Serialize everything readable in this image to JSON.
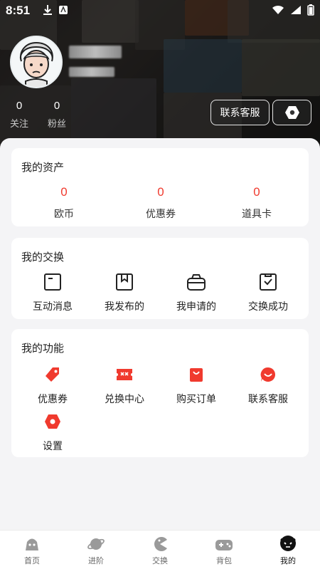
{
  "status_bar": {
    "time": "8:51"
  },
  "profile": {
    "following_count": "0",
    "following_label": "关注",
    "fans_count": "0",
    "fans_label": "粉丝"
  },
  "header_buttons": {
    "support_label": "联系客服"
  },
  "assets": {
    "title": "我的资产",
    "items": [
      {
        "value": "0",
        "label": "欧币"
      },
      {
        "value": "0",
        "label": "优惠券"
      },
      {
        "value": "0",
        "label": "道具卡"
      }
    ]
  },
  "exchange": {
    "title": "我的交换",
    "items": [
      {
        "label": "互动消息",
        "icon": "message-box-icon"
      },
      {
        "label": "我发布的",
        "icon": "box-icon"
      },
      {
        "label": "我申请的",
        "icon": "basket-icon"
      },
      {
        "label": "交换成功",
        "icon": "check-box-icon"
      }
    ]
  },
  "features": {
    "title": "我的功能",
    "items": [
      {
        "label": "优惠券",
        "icon": "coupon-tag-icon"
      },
      {
        "label": "兑换中心",
        "icon": "redeem-ticket-icon"
      },
      {
        "label": "购买订单",
        "icon": "shopping-bag-icon"
      },
      {
        "label": "联系客服",
        "icon": "customer-service-icon"
      },
      {
        "label": "设置",
        "icon": "settings-icon"
      }
    ]
  },
  "tabbar": {
    "items": [
      {
        "label": "首页",
        "icon": "home-icon"
      },
      {
        "label": "进阶",
        "icon": "planet-icon"
      },
      {
        "label": "交换",
        "icon": "pacman-icon"
      },
      {
        "label": "背包",
        "icon": "gamepad-icon"
      },
      {
        "label": "我的",
        "icon": "profile-mascot-icon"
      }
    ],
    "active_index": 4
  },
  "colors": {
    "accent": "#f03a2e",
    "text": "#222222",
    "background": "#f4f4f6"
  }
}
